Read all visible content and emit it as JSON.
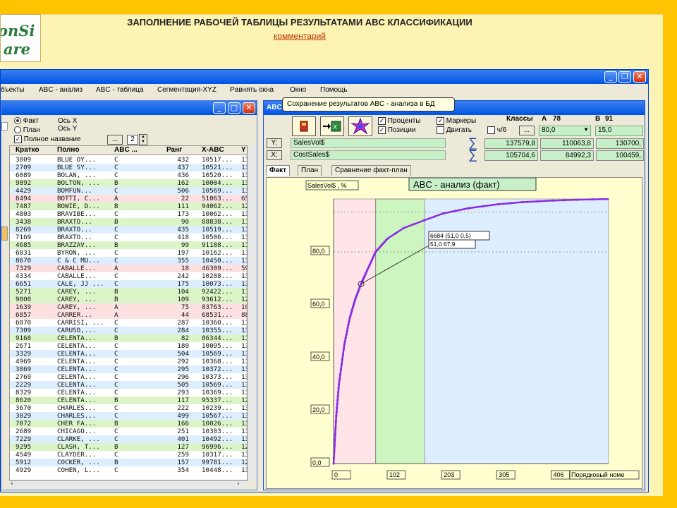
{
  "slide": {
    "title": "ЗАПОЛНЕНИЕ РАБОЧЕЙ ТАБЛИЦЫ РЕЗУЛЬТАТАМИ ABC КЛАССИФИКАЦИИ",
    "subtitle_link": "комментарий",
    "logo_line1": "onSi",
    "logo_line2": "are"
  },
  "menu": [
    "бъекты",
    "ABC - анализ",
    "ABC - таблица",
    "Сегментация-XYZ",
    "Рaвнять окна",
    "Окно",
    "Помощь"
  ],
  "tooltip": "Сохранение результатов ABC - анализа в БД",
  "left_window": {
    "radio_fact": "Факт",
    "radio_plan": "План",
    "axis_x": "Ось X",
    "axis_y": "Ось Y",
    "full_name": "Полное название",
    "spinner_value": "2",
    "ellipsis": "...",
    "columns": [
      "Кратко",
      "Полно",
      "ABC ...",
      "Ранг",
      "X-ABC",
      "Y"
    ],
    "rows": [
      [
        "3809",
        "BLUE OY...",
        "C",
        "432",
        "10517...",
        "13("
      ],
      [
        "2709",
        "BLUE SY...",
        "C",
        "437",
        "10521...",
        "13("
      ],
      [
        "6089",
        "BOLAN, ...",
        "C",
        "436",
        "10520...",
        "13("
      ],
      [
        "9892",
        "BOLTON, ...",
        "B",
        "162",
        "10004...",
        "13("
      ],
      [
        "4429",
        "BOMFUN...",
        "C",
        "506",
        "10569...",
        "13"
      ],
      [
        "8494",
        "BOTTI, C...",
        "A",
        "22",
        "51063...",
        "65("
      ],
      [
        "7487",
        "BOWIE, D...",
        "B",
        "111",
        "94062...",
        "12"
      ],
      [
        "4803",
        "BRAVIBE...",
        "C",
        "173",
        "10062...",
        "13("
      ],
      [
        "3438",
        "BRAXTO...",
        "B",
        "90",
        "88838...",
        "11!"
      ],
      [
        "8269",
        "BRAXTO...",
        "C",
        "435",
        "10519...",
        "13("
      ],
      [
        "7169",
        "BRAXTO...",
        "C",
        "418",
        "10506...",
        "13("
      ],
      [
        "4685",
        "BRAZZAV...",
        "B",
        "99",
        "91188...",
        "11("
      ],
      [
        "6031",
        "BYRON, ...",
        "C",
        "197",
        "10162...",
        "13"
      ],
      [
        "8670",
        "C & C MU...",
        "C",
        "355",
        "10450...",
        "13("
      ],
      [
        "7329",
        "CABALLE...",
        "A",
        "18",
        "46309...",
        "59"
      ],
      [
        "4334",
        "CABALLE...",
        "C",
        "242",
        "10288...",
        "13"
      ],
      [
        "6651",
        "CALE, JJ ...",
        "C",
        "175",
        "10073...",
        "13"
      ],
      [
        "5271",
        "CAREY, ...",
        "B",
        "104",
        "92422...",
        "11!"
      ],
      [
        "9808",
        "CAREY, ...",
        "B",
        "109",
        "93612...",
        "12"
      ],
      [
        "1639",
        "CAREY, ...",
        "A",
        "75",
        "83763...",
        "10!"
      ],
      [
        "6857",
        "CARRER...",
        "A",
        "44",
        "68531...",
        "88"
      ],
      [
        "6070",
        "CARRISI, ...",
        "C",
        "287",
        "10360...",
        "13"
      ],
      [
        "7309",
        "CARUSO,...",
        "C",
        "284",
        "10355...",
        "13"
      ],
      [
        "9168",
        "CELENTA...",
        "B",
        "82",
        "86344...",
        "11"
      ],
      [
        "2671",
        "CELENTA...",
        "C",
        "180",
        "10095...",
        "13"
      ],
      [
        "3329",
        "CELENTA...",
        "C",
        "504",
        "10569...",
        "13"
      ],
      [
        "4969",
        "CELENTA...",
        "C",
        "292",
        "10368...",
        "13"
      ],
      [
        "3869",
        "CELENTA...",
        "C",
        "295",
        "10372...",
        "13!"
      ],
      [
        "2769",
        "CELENTA...",
        "C",
        "296",
        "10373...",
        "13!"
      ],
      [
        "2229",
        "CELENTA...",
        "C",
        "505",
        "10569...",
        "13"
      ],
      [
        "8329",
        "CELENTA...",
        "C",
        "293",
        "10369...",
        "13"
      ],
      [
        "8620",
        "CELENTA...",
        "B",
        "117",
        "95337...",
        "12"
      ],
      [
        "3670",
        "CHARLES...",
        "C",
        "222",
        "10239...",
        "13"
      ],
      [
        "3029",
        "CHARLES...",
        "C",
        "499",
        "10567...",
        "13"
      ],
      [
        "7072",
        "CHER FA...",
        "B",
        "166",
        "10026...",
        "13("
      ],
      [
        "2689",
        "CHICAGO...",
        "C",
        "251",
        "10303...",
        "13"
      ],
      [
        "7229",
        "CLARKE, ...",
        "C",
        "401",
        "10492...",
        "13("
      ],
      [
        "9295",
        "CLASH, T...",
        "B",
        "127",
        "96996...",
        "12"
      ],
      [
        "4549",
        "CLAYDER...",
        "C",
        "259",
        "10317...",
        "13"
      ],
      [
        "5912",
        "COCKER, ...",
        "B",
        "157",
        "99781...",
        "12"
      ],
      [
        "4929",
        "COHEN, L...",
        "C",
        "354",
        "10448...",
        "13("
      ]
    ],
    "row_styles": [
      "w",
      "b",
      "w",
      "g",
      "b",
      "p",
      "g",
      "w",
      "g",
      "b",
      "w",
      "g",
      "w",
      "b",
      "p",
      "w",
      "b",
      "g",
      "g",
      "p",
      "p",
      "w",
      "b",
      "g",
      "w",
      "b",
      "w",
      "b",
      "w",
      "b",
      "w",
      "g",
      "w",
      "b",
      "g",
      "w",
      "b",
      "g",
      "w",
      "b",
      "w"
    ]
  },
  "right_window": {
    "title": "ABC",
    "check_percent": "Проценты",
    "check_positions": "Позиции",
    "check_markers": "Маркеры",
    "check_move": "Двигать",
    "check_ch6": "ч/6",
    "classes_label": "Классы",
    "class_a_label": "A",
    "class_a_value": "78",
    "class_b_label": "B",
    "class_b_value": "91",
    "class_a_pct": "80,0",
    "class_b_pct": "15,0",
    "btn_y": "Y:",
    "btn_x": "X:",
    "field_y": "SalesVol$",
    "field_x": "CostSales$",
    "sum_y": [
      "137579,8",
      "110063,8",
      "130700,"
    ],
    "sum_x": [
      "105704,6",
      "84992,3",
      "100459,"
    ],
    "tabs": [
      "Факт",
      "План",
      "Сравнение факт-план"
    ]
  },
  "chart_data": {
    "type": "line",
    "title": "ABC - анализ (факт)",
    "ylabel": "SalesVol$ , %",
    "xlabel": "Порядковый номе",
    "ylim": [
      0,
      100
    ],
    "xlim": [
      0,
      510
    ],
    "y_ticks": [
      "0,0",
      "20,0",
      "40,0",
      "60,0",
      "80,0"
    ],
    "x_ticks": [
      "0",
      "102",
      "203",
      "305",
      "406"
    ],
    "class_boundaries": {
      "A_end": 78,
      "B_end": 169
    },
    "zone_colors": {
      "A": "#ffe4e8",
      "B": "#ccf5c0",
      "C": "#dceeff"
    },
    "curve_color": "#8a2be2",
    "annotation_line1": "6684 (51,0 0,5)",
    "annotation_line2": "51,0 67,9",
    "annotated_point": {
      "x": 51,
      "y": 67.9
    },
    "series": [
      {
        "x": [
          0,
          5,
          10,
          20,
          30,
          40,
          51,
          60,
          78,
          100,
          130,
          169,
          203,
          250,
          305,
          350,
          406,
          450,
          510
        ],
        "y": [
          0,
          18,
          30,
          45,
          55,
          62,
          67.9,
          72,
          80,
          85,
          89,
          92,
          94.5,
          96.5,
          98,
          98.8,
          99.4,
          99.7,
          100
        ]
      }
    ]
  }
}
